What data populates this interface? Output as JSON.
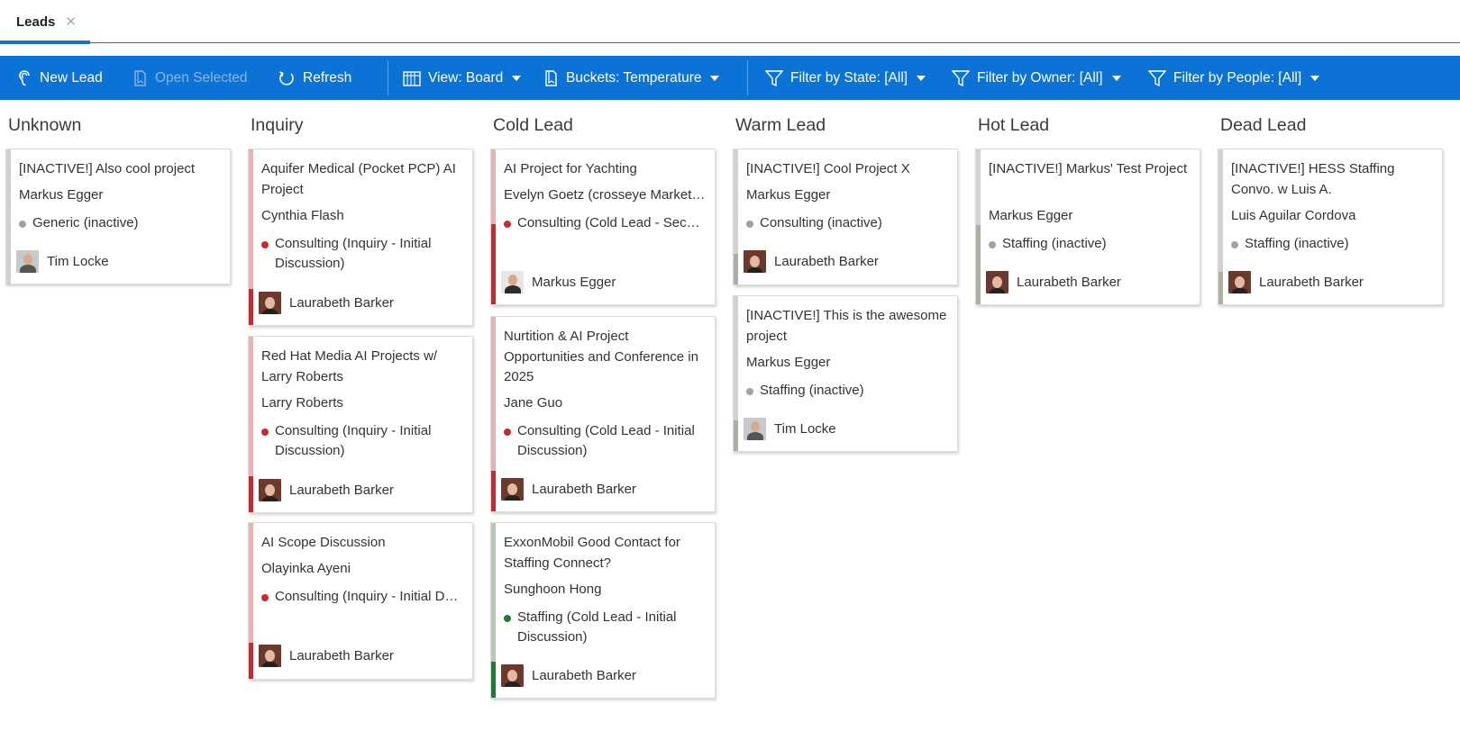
{
  "tab": {
    "label": "Leads",
    "close": "✕"
  },
  "toolbar": {
    "new_lead": "New Lead",
    "open_selected": "Open Selected",
    "refresh": "Refresh",
    "view": "View: Board",
    "buckets": "Buckets: Temperature",
    "filter_state": "Filter by State: [All]",
    "filter_owner": "Filter by Owner: [All]",
    "filter_people": "Filter by People: [All]"
  },
  "colors": {
    "accent": "#0b73d6",
    "inactive_dot": "#9aa89a",
    "red_dot": "#c62a2f",
    "green_dot": "#1f7a35",
    "red_bar_light": "#e6b3b5",
    "red_bar_dark": "#c62a2f",
    "green_bar_light": "#b7c9b7",
    "green_bar_dark": "#1f7a35",
    "gray_bar_light": "#d0d4cc",
    "gray_bar_dark": "#a9b0a4"
  },
  "columns": [
    {
      "title": "Unknown",
      "cards": [
        {
          "title": "[INACTIVE!] Also cool project",
          "contact": "Markus Egger",
          "status": "Generic (inactive)",
          "owner": "Tim Locke"
        }
      ]
    },
    {
      "title": "Inquiry",
      "cards": [
        {
          "title": "Aquifer Medical (Pocket PCP) AI Project",
          "contact": "Cynthia Flash",
          "status": "Consulting (Inquiry - Initial Discussion)",
          "owner": "Laurabeth Barker"
        },
        {
          "title": "Red Hat Media AI Projects w/ Larry Roberts",
          "contact": "Larry Roberts",
          "status": "Consulting (Inquiry - Initial Discussion)",
          "owner": "Laurabeth Barker"
        },
        {
          "title": "AI Scope Discussion",
          "contact": "Olayinka Ayeni",
          "status": "Consulting (Inquiry - Initial Discussion)",
          "owner": "Laurabeth Barker"
        }
      ]
    },
    {
      "title": "Cold Lead",
      "cards": [
        {
          "title": "AI Project for Yachting",
          "contact": "Evelyn Goetz (crosseye Marketing)",
          "status": "Consulting (Cold Lead - Second Discussion)",
          "owner": "Markus Egger"
        },
        {
          "title": "Nurtition & AI Project Opportunities and Conference in 2025",
          "contact": "Jane Guo",
          "status": "Consulting (Cold Lead - Initial Discussion)",
          "owner": "Laurabeth Barker"
        },
        {
          "title": "ExxonMobil Good Contact for Staffing Connect?",
          "contact": "Sunghoon Hong",
          "status": "Staffing (Cold Lead - Initial Discussion)",
          "owner": "Laurabeth Barker"
        }
      ]
    },
    {
      "title": "Warm Lead",
      "cards": [
        {
          "title": "[INACTIVE!] Cool Project X",
          "contact": "Markus Egger",
          "status": "Consulting (inactive)",
          "owner": "Laurabeth Barker"
        },
        {
          "title": "[INACTIVE!] This is the awesome project",
          "contact": "Markus Egger",
          "status": "Staffing (inactive)",
          "owner": "Tim Locke"
        }
      ]
    },
    {
      "title": "Hot Lead",
      "cards": [
        {
          "title": "[INACTIVE!] Markus' Test Project",
          "contact": "Markus Egger",
          "status": "Staffing (inactive)",
          "owner": "Laurabeth Barker"
        }
      ]
    },
    {
      "title": "Dead Lead",
      "cards": [
        {
          "title": "[INACTIVE!] HESS Staffing Convo. w Luis A.",
          "contact": "Luis Aguilar Cordova",
          "status": "Staffing (inactive)",
          "owner": "Laurabeth Barker"
        }
      ]
    }
  ]
}
